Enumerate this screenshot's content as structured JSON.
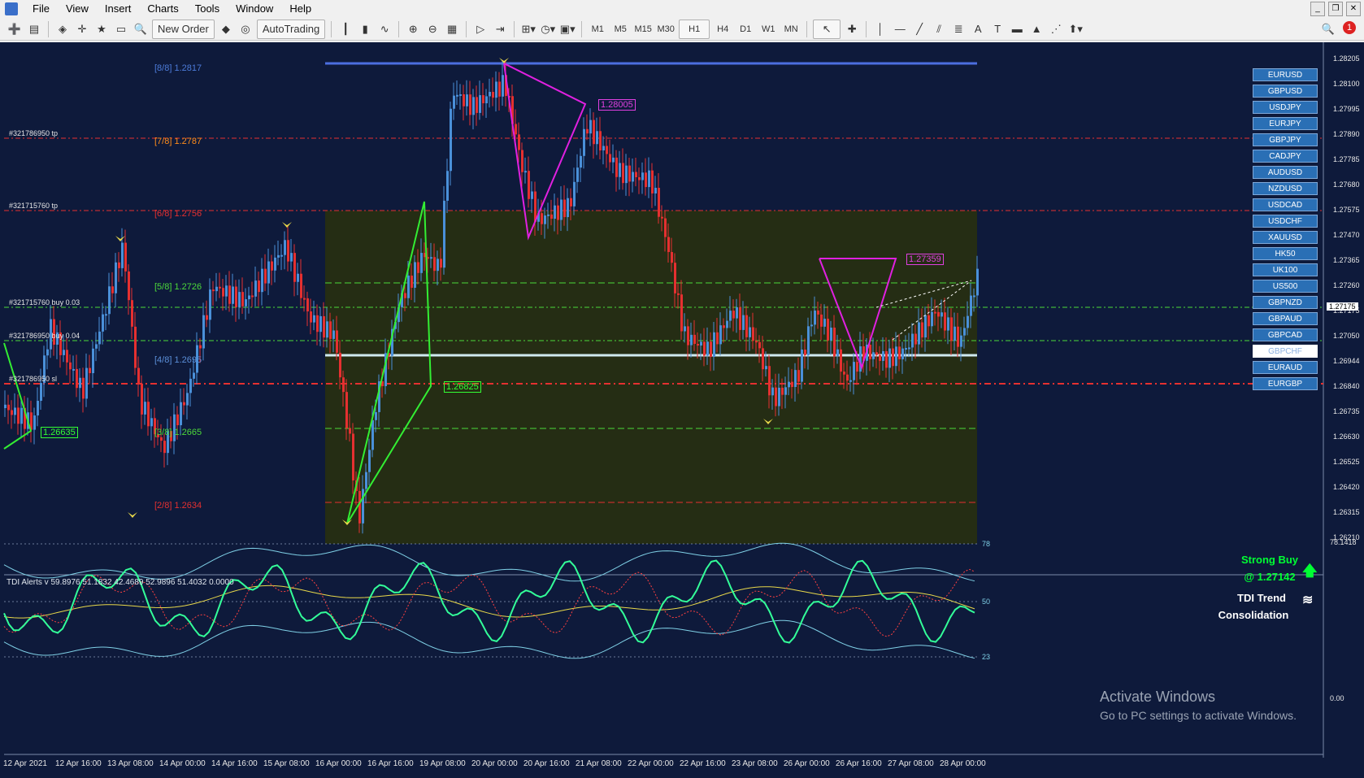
{
  "menu": [
    "File",
    "View",
    "Insert",
    "Charts",
    "Tools",
    "Window",
    "Help"
  ],
  "toolbar": {
    "new_order": "New Order",
    "autotrading": "AutoTrading",
    "timeframes": [
      "M1",
      "M5",
      "M15",
      "M30",
      "H1",
      "H4",
      "D1",
      "W1",
      "MN"
    ]
  },
  "notifications": {
    "count": "1"
  },
  "colors": {
    "chart_bg": "#0e1a3b",
    "bull": "#4a90d9",
    "bear": "#e53030",
    "accent": "#00ff66"
  },
  "murrey": {
    "levels": [
      {
        "label": "[8/8]",
        "price": "1.2817",
        "color": "#4c7bd9"
      },
      {
        "label": "[7/8]",
        "price": "1.2787",
        "color": "#ff8c1a"
      },
      {
        "label": "[6/8]",
        "price": "1.2756",
        "color": "#e53030"
      },
      {
        "label": "[5/8]",
        "price": "1.2726",
        "color": "#4cd93a"
      },
      {
        "label": "[4/8]",
        "price": "1.2695",
        "color": "#5b8fd9"
      },
      {
        "label": "[3/8]",
        "price": "1.2665",
        "color": "#4cd93a"
      },
      {
        "label": "[2/8]",
        "price": "1.2634",
        "color": "#e53030"
      }
    ]
  },
  "orders": [
    "#321786950 tp",
    "#321715760 tp",
    "#321715760 buy 0.03",
    "#321786950 buy 0.04",
    "#321786950 sl"
  ],
  "price_boxes": {
    "top": "1.28005",
    "right_top": "1.27359",
    "mid": "1.26825",
    "left": "1.26635"
  },
  "price_axis": [
    "1.28205",
    "1.28100",
    "1.27995",
    "1.27890",
    "1.27785",
    "1.27680",
    "1.27575",
    "1.27470",
    "1.27365",
    "1.27260",
    "1.27175",
    "1.27050",
    "1.26944",
    "1.26840",
    "1.26735",
    "1.26630",
    "1.26525",
    "1.26420",
    "1.26315",
    "1.26210"
  ],
  "current_price": "1.27175",
  "symbols": [
    "EURUSD",
    "GBPUSD",
    "USDJPY",
    "EURJPY",
    "GBPJPY",
    "CADJPY",
    "AUDUSD",
    "NZDUSD",
    "USDCAD",
    "USDCHF",
    "XAUUSD",
    "HK50",
    "UK100",
    "US500",
    "GBPNZD",
    "GBPAUD",
    "GBPCAD",
    "GBPCHF",
    "EURAUD",
    "EURGBP"
  ],
  "active_symbol": "GBPCHF",
  "tdi": {
    "title": "TDI Alerts v 59.8976 51.1832 42.4689 52.9896 51.4032 0.0000",
    "levels": [
      "78",
      "50",
      "23"
    ],
    "axis_top": "78.1418",
    "axis_bottom": "0.00"
  },
  "signals": {
    "strong_buy": "Strong Buy",
    "at_price": "@ 1.27142",
    "trend_label": "TDI Trend",
    "trend_state": "Consolidation"
  },
  "time_axis": [
    "12 Apr 2021",
    "12 Apr 16:00",
    "13 Apr 08:00",
    "14 Apr 00:00",
    "14 Apr 16:00",
    "15 Apr 08:00",
    "16 Apr 00:00",
    "16 Apr 16:00",
    "19 Apr 08:00",
    "20 Apr 00:00",
    "20 Apr 16:00",
    "21 Apr 08:00",
    "22 Apr 00:00",
    "22 Apr 16:00",
    "23 Apr 08:00",
    "26 Apr 00:00",
    "26 Apr 16:00",
    "27 Apr 08:00",
    "28 Apr 00:00"
  ],
  "watermark": {
    "title": "Activate Windows",
    "subtitle": "Go to PC settings to activate Windows."
  }
}
